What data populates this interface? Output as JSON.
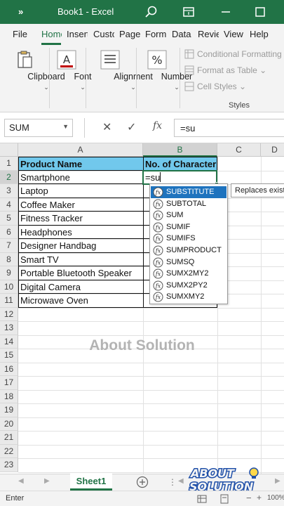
{
  "titlebar": {
    "qa_glyph": "»",
    "title": "Book1 - Excel",
    "accent": "#217346"
  },
  "tabs": [
    {
      "label": "File"
    },
    {
      "label": "Home"
    },
    {
      "label": "Insert"
    },
    {
      "label": "Custom"
    },
    {
      "label": "Page"
    },
    {
      "label": "Form"
    },
    {
      "label": "Data"
    },
    {
      "label": "Review"
    },
    {
      "label": "View"
    },
    {
      "label": "Help"
    }
  ],
  "active_tab": "Home",
  "ribbon": {
    "clipboard": "Clipboard",
    "font": "Font",
    "alignment": "Alignment",
    "number": "Number",
    "number_symbol": "%",
    "font_symbol": "A",
    "styles_items": [
      "Conditional Formatting",
      "Format as Table",
      "Cell Styles"
    ],
    "styles_group": "Styles"
  },
  "formula_bar": {
    "name_box": "SUM",
    "cancel": "✕",
    "enter": "✓",
    "fx": "fx",
    "content": "=su"
  },
  "columns": [
    "A",
    "B",
    "C",
    "D"
  ],
  "rows": [
    "1",
    "2",
    "3",
    "4",
    "5",
    "6",
    "7",
    "8",
    "9",
    "10",
    "11",
    "12",
    "13",
    "14",
    "15",
    "16",
    "17",
    "18",
    "19",
    "20",
    "21",
    "22",
    "23"
  ],
  "table": {
    "header": [
      "Product Name",
      "No. of Character"
    ],
    "header_color": "#71c8ec",
    "products": [
      "Smartphone",
      "Laptop",
      "Coffee Maker",
      "Fitness Tracker",
      "Headphones",
      "Designer Handbag",
      "Smart TV",
      "Portable Bluetooth Speaker",
      "Digital Camera",
      "Microwave Oven"
    ]
  },
  "active_cell_value": "=su",
  "autocomplete": {
    "items": [
      "SUBSTITUTE",
      "SUBTOTAL",
      "SUM",
      "SUMIF",
      "SUMIFS",
      "SUMPRODUCT",
      "SUMSQ",
      "SUMX2MY2",
      "SUMX2PY2",
      "SUMXMY2"
    ],
    "highlighted": "SUBSTITUTE",
    "highlight_color": "#1e73be",
    "tooltip": "Replaces existing"
  },
  "watermark": "About Solution",
  "sheets": [
    "Sheet1"
  ],
  "logo": {
    "line1": "ABOUT",
    "line2": "SOLUTION"
  },
  "status": {
    "mode": "Enter",
    "zoom": "100%"
  }
}
